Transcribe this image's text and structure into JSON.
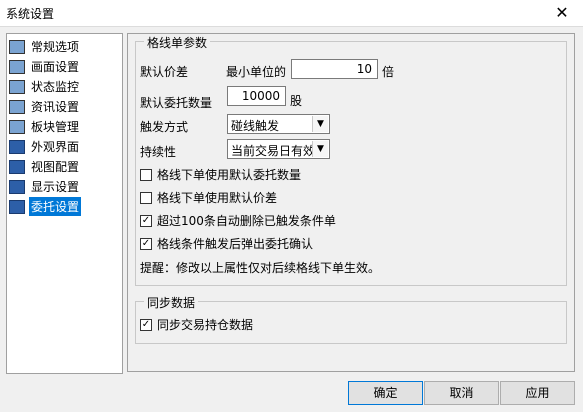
{
  "window": {
    "title": "系统设置",
    "close_glyph": "✕"
  },
  "sidebar": {
    "items": [
      {
        "label": "常规选项",
        "icon": "general-options-icon"
      },
      {
        "label": "画面设置",
        "icon": "display-settings-icon"
      },
      {
        "label": "状态监控",
        "icon": "status-monitor-icon"
      },
      {
        "label": "资讯设置",
        "icon": "news-settings-icon"
      },
      {
        "label": "板块管理",
        "icon": "sector-management-icon"
      },
      {
        "label": "外观界面",
        "icon": "monitor-icon"
      },
      {
        "label": "视图配置",
        "icon": "monitor-icon"
      },
      {
        "label": "显示设置",
        "icon": "monitor-icon"
      },
      {
        "label": "委托设置",
        "icon": "monitor-icon",
        "selected": true
      }
    ]
  },
  "grid_params": {
    "legend": "格线单参数",
    "default_price_diff_label": "默认价差",
    "min_unit_label": "最小单位的",
    "min_unit_value": "10",
    "times_label": "倍",
    "default_qty_label": "默认委托数量",
    "default_qty_value": "10000",
    "qty_unit": "股",
    "trigger_label": "触发方式",
    "trigger_value": "碰线触发",
    "duration_label": "持续性",
    "duration_value": "当前交易日有效",
    "checkboxes": [
      {
        "label": "格线下单使用默认委托数量",
        "checked": false
      },
      {
        "label": "格线下单使用默认价差",
        "checked": false
      },
      {
        "label": "超过100条自动删除已触发条件单",
        "checked": true
      },
      {
        "label": "格线条件触发后弹出委托确认",
        "checked": true
      }
    ],
    "note": "提醒：修改以上属性仅对后续格线下单生效。"
  },
  "sync": {
    "legend": "同步数据",
    "checkbox_label": "同步交易持仓数据",
    "checked": true
  },
  "buttons": {
    "ok": "确定",
    "cancel": "取消",
    "apply": "应用"
  }
}
